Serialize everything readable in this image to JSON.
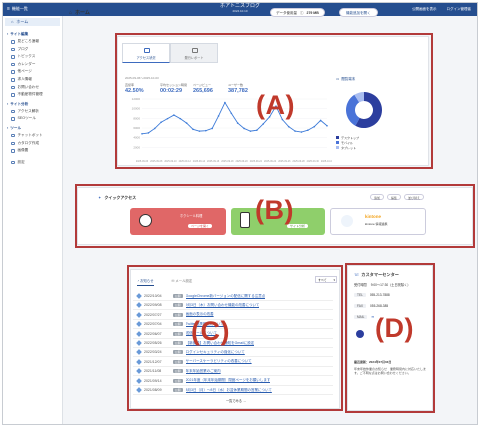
{
  "topbar": {
    "menu_label": "機能一覧",
    "brand": "ホアトニスブログ",
    "brand_sub": "2024.10.10",
    "link_admin": "公開画面を表示",
    "link_account": "ログイン管理者"
  },
  "sidebar": {
    "home": "ホーム",
    "sections": [
      {
        "title": "サイト編集",
        "items": [
          "見どころ速報",
          "ブログ",
          "トピックス",
          "カレンダー",
          "他ページ",
          "求人情報",
          "お問い合わせ",
          "不動産物件管理"
        ]
      },
      {
        "title": "サイト分析",
        "items": [
          "アクセス解析",
          "SEOツール"
        ]
      },
      {
        "title": "ツール",
        "items": [
          "チャットボット",
          "カタログ作成",
          "画像置"
        ]
      }
    ],
    "settings": "設定"
  },
  "header": {
    "title": "ホーム",
    "usage_label": "データ使用量",
    "usage_value": "279 MB",
    "manual_button": "機能追加を開く"
  },
  "analytics": {
    "tabs": [
      "アクセス状況",
      "発行レポート"
    ],
    "period": "2025-09-06〜2025-10-03",
    "kpis": [
      {
        "label": "直帰率",
        "value": "42.50%"
      },
      {
        "label": "平均セッション時間",
        "value": "00:02:29"
      },
      {
        "label": "ページビュー",
        "value": "265,696"
      },
      {
        "label": "ユーザー数",
        "value": "387,782"
      }
    ],
    "device_title": "閲覧端末",
    "devices": [
      {
        "name": "デスクトップ",
        "color": "#2c3e9e"
      },
      {
        "name": "モバイル",
        "color": "#4a73d8"
      },
      {
        "name": "タブレット",
        "color": "#a9bdf0"
      }
    ],
    "device_values": [
      58,
      33,
      9
    ],
    "ylabels": [
      "12000",
      "10000",
      "8000",
      "6000",
      "4000",
      "2000"
    ],
    "series": [
      5200,
      5400,
      6400,
      7800,
      8600,
      9400,
      8600,
      7600,
      6200,
      5800,
      5900,
      6400,
      9200,
      12200,
      9800,
      7600,
      6400,
      5800,
      6000,
      7400,
      9000,
      11400,
      8400,
      6800,
      5800,
      5600,
      6000,
      6800,
      8200,
      7000
    ],
    "ymax": 13000,
    "xlabels": [
      "2025-09-06",
      "2025-09-08",
      "2025-09-10",
      "2025-09-12",
      "2025-09-14",
      "2025-09-16",
      "2025-09-18",
      "2025-09-20",
      "2025-09-22",
      "2025-09-24",
      "2025-09-26",
      "2025-09-28",
      "2025-09-30",
      "2025-10-02"
    ]
  },
  "quick": {
    "title": "クイックアクセス",
    "buttons": [
      "追加",
      "編集",
      "並び替え"
    ],
    "cards": [
      {
        "label": "ホクシール料理",
        "sub": "ページを開く",
        "color": "#e06767"
      },
      {
        "label": "",
        "sub": "サイト分析",
        "color": "#8fcf6b"
      }
    ],
    "kintone_logo": "kintone",
    "kintone_text": "kintone 情報連携"
  },
  "news": {
    "tabs": [
      "お知らせ",
      "メール設定"
    ],
    "filter": "すべて",
    "rows": [
      {
        "date": "2022/10/04",
        "tag": "公開",
        "title": "GoogleChrome新バージョンの配信に関する注意点"
      },
      {
        "date": "2022/09/08",
        "tag": "公開",
        "title": "9月3日（木）お問い合わせ機能の改善について"
      },
      {
        "date": "2022/07/27",
        "tag": "公開",
        "title": "画面の表示の改善"
      },
      {
        "date": "2022/07/04",
        "tag": "公開",
        "title": "Twitter連携機能について"
      },
      {
        "date": "2022/06/07",
        "tag": "公開",
        "title": "送信メールについて"
      },
      {
        "date": "2022/05/26",
        "tag": "公開",
        "title": "【新機能】お問い合わせ通知をGmailに設定"
      },
      {
        "date": "2022/03/24",
        "tag": "公開",
        "title": "ログインセキュリティの強化について"
      },
      {
        "date": "2021/12/07",
        "tag": "公開",
        "title": "サーバースケーラビリティの改善について"
      },
      {
        "date": "2021/11/08",
        "tag": "公開",
        "title": "年末年始営業のご案内"
      },
      {
        "date": "2021/09/14",
        "tag": "公開",
        "title": "2021年度（年末年始期間）閉館ページをお願いします"
      },
      {
        "date": "2021/08/09",
        "tag": "公開",
        "title": "8月3日（月）〜8日（水）お盆休業期間の営業について"
      }
    ],
    "more": "一覧でみる"
  },
  "center": {
    "title": "カスタマーセンター",
    "hours_label": "受付時間",
    "hours": "9:00〜17:30（土日祝除く）",
    "tel_label": "TEL",
    "tel": "055-213-7888",
    "fax_label": "FAX",
    "fax": "055-268-385",
    "mail_label": "MAIL",
    "note_title": "最近更新：2024年07月03日",
    "note": "年末年始休業のお知らせ　業務時間内に対応いたします。ご不明な点はお問い合わせください。"
  },
  "overlay_labels": [
    "(A)",
    "(B)",
    "(C)",
    "(D)"
  ]
}
